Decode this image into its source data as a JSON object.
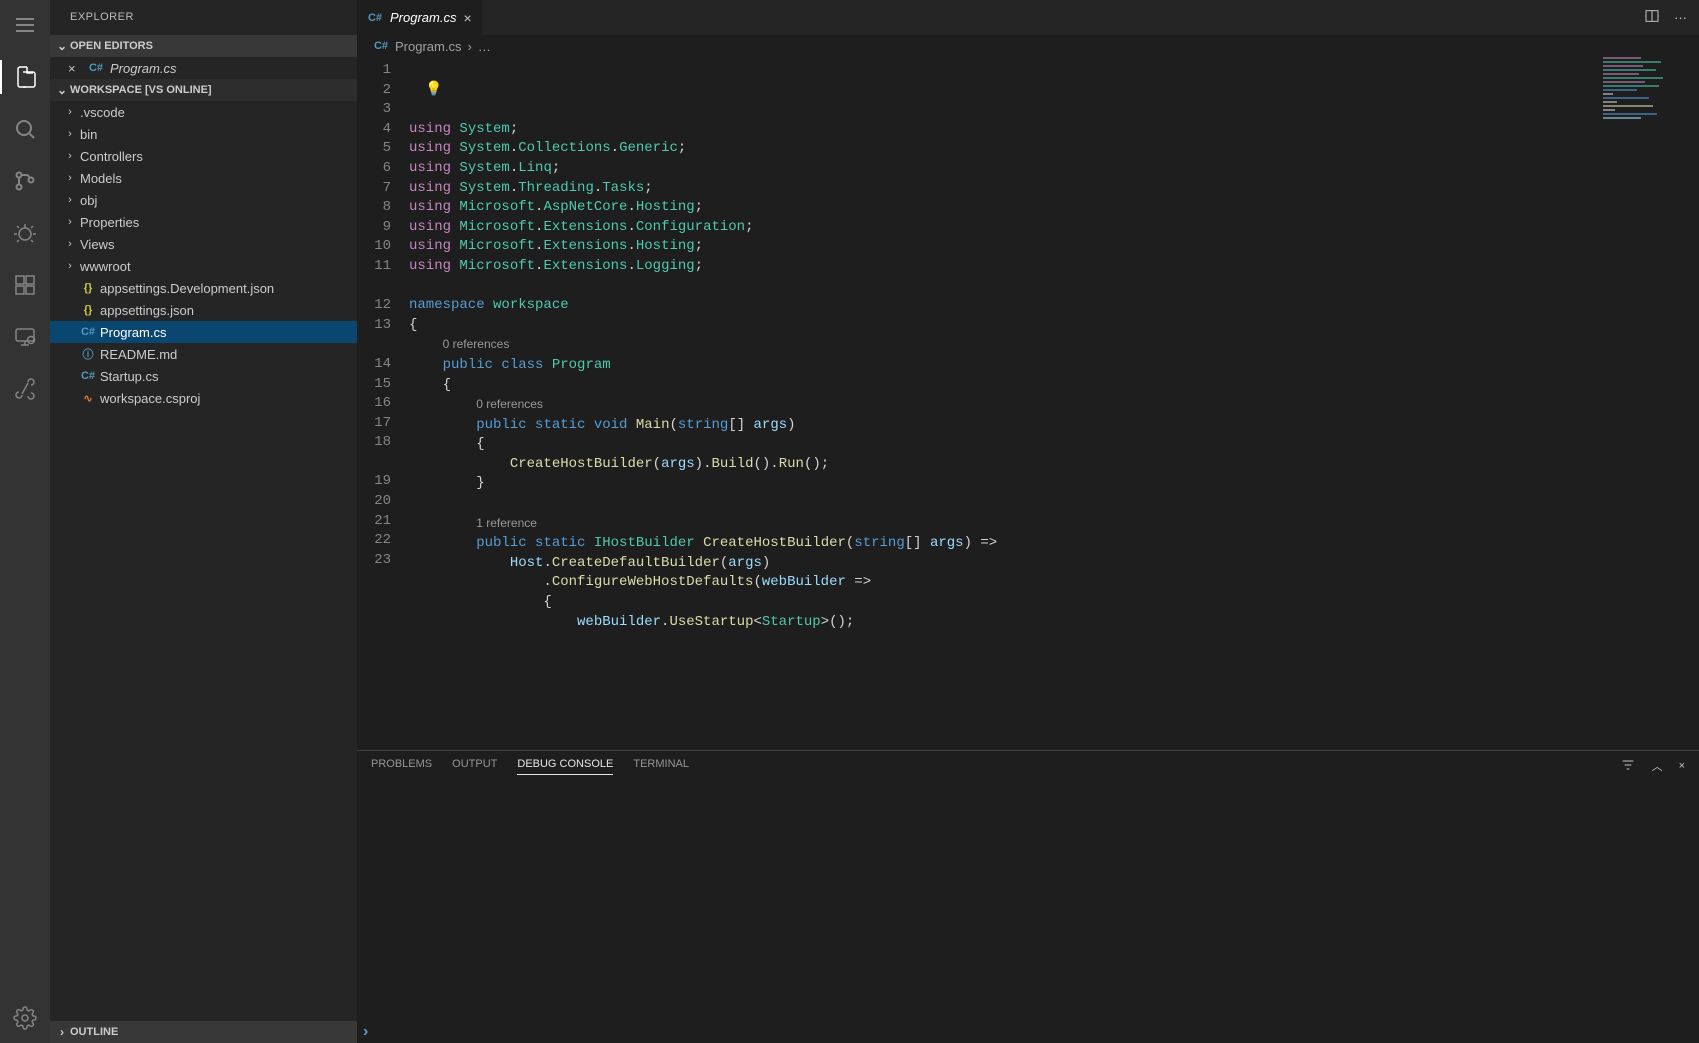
{
  "sidebar": {
    "title": "EXPLORER",
    "openEditors": {
      "label": "Open Editors",
      "items": [
        {
          "name": "Program.cs",
          "iconText": "C#"
        }
      ]
    },
    "workspace": {
      "label": "Workspace [VS Online]",
      "folders": [
        {
          "name": ".vscode"
        },
        {
          "name": "bin"
        },
        {
          "name": "Controllers"
        },
        {
          "name": "Models"
        },
        {
          "name": "obj"
        },
        {
          "name": "Properties"
        },
        {
          "name": "Views"
        },
        {
          "name": "wwwroot"
        }
      ],
      "files": [
        {
          "name": "appsettings.Development.json",
          "iconText": "{}",
          "iconClass": "fi-json"
        },
        {
          "name": "appsettings.json",
          "iconText": "{}",
          "iconClass": "fi-json"
        },
        {
          "name": "Program.cs",
          "iconText": "C#",
          "iconClass": "fi-cs",
          "selected": true
        },
        {
          "name": "README.md",
          "iconText": "ⓘ",
          "iconClass": "fi-info"
        },
        {
          "name": "Startup.cs",
          "iconText": "C#",
          "iconClass": "fi-cs"
        },
        {
          "name": "workspace.csproj",
          "iconText": "∿",
          "iconClass": "fi-rss"
        }
      ]
    },
    "outline": {
      "label": "Outline"
    }
  },
  "tab": {
    "name": "Program.cs",
    "iconText": "C#"
  },
  "breadcrumb": {
    "file": "Program.cs",
    "sep": "›",
    "tail": "…"
  },
  "code": {
    "codelens0": "0 references",
    "codelens1": "0 references",
    "codelens2": "1 reference",
    "l1": {
      "a": "using",
      "b": " System",
      "c": ";"
    },
    "l2": {
      "a": "using",
      "b": " System",
      "c": ".",
      "d": "Collections",
      "e": ".",
      "f": "Generic",
      "g": ";"
    },
    "l3": {
      "a": "using",
      "b": " System",
      "c": ".",
      "d": "Linq",
      "e": ";"
    },
    "l4": {
      "a": "using",
      "b": " System",
      "c": ".",
      "d": "Threading",
      "e": ".",
      "f": "Tasks",
      "g": ";"
    },
    "l5": {
      "a": "using",
      "b": " Microsoft",
      "c": ".",
      "d": "AspNetCore",
      "e": ".",
      "f": "Hosting",
      "g": ";"
    },
    "l6": {
      "a": "using",
      "b": " Microsoft",
      "c": ".",
      "d": "Extensions",
      "e": ".",
      "f": "Configuration",
      "g": ";"
    },
    "l7": {
      "a": "using",
      "b": " Microsoft",
      "c": ".",
      "d": "Extensions",
      "e": ".",
      "f": "Hosting",
      "g": ";"
    },
    "l8": {
      "a": "using",
      "b": " Microsoft",
      "c": ".",
      "d": "Extensions",
      "e": ".",
      "f": "Logging",
      "g": ";"
    },
    "l10": {
      "a": "namespace",
      "b": " workspace"
    },
    "l11": "{",
    "l12": {
      "a": "public",
      "b": " class",
      "c": " Program"
    },
    "l13": "{",
    "l14": {
      "a": "public",
      "b": " static",
      "c": " void",
      "d": " Main",
      "e": "(",
      "f": "string",
      "g": "[] ",
      "h": "args",
      "i": ")"
    },
    "l15": "{",
    "l16": {
      "a": "CreateHostBuilder",
      "b": "(",
      "c": "args",
      "d": ").",
      "e": "Build",
      "f": "().",
      "g": "Run",
      "h": "();"
    },
    "l17": "}",
    "l19": {
      "a": "public",
      "b": " static",
      "c": " IHostBuilder",
      "d": " CreateHostBuilder",
      "e": "(",
      "f": "string",
      "g": "[] ",
      "h": "args",
      "i": ") =>"
    },
    "l20": {
      "a": "Host",
      "b": ".",
      "c": "CreateDefaultBuilder",
      "d": "(",
      "e": "args",
      "f": ")"
    },
    "l21": {
      "a": ".",
      "b": "ConfigureWebHostDefaults",
      "c": "(",
      "d": "webBuilder",
      "e": " =>"
    },
    "l22": "{",
    "l23": {
      "a": "webBuilder",
      "b": ".",
      "c": "UseStartup",
      "d": "<",
      "e": "Startup",
      "f": ">();"
    }
  },
  "lineNumbers": [
    "1",
    "2",
    "3",
    "4",
    "5",
    "6",
    "7",
    "8",
    "9",
    "10",
    "11",
    "",
    "12",
    "13",
    "",
    "14",
    "15",
    "16",
    "17",
    "18",
    "",
    "19",
    "20",
    "21",
    "22",
    "23"
  ],
  "panel": {
    "tabs": {
      "problems": "Problems",
      "output": "Output",
      "debugConsole": "Debug Console",
      "terminal": "Terminal"
    },
    "prompt": "›"
  }
}
